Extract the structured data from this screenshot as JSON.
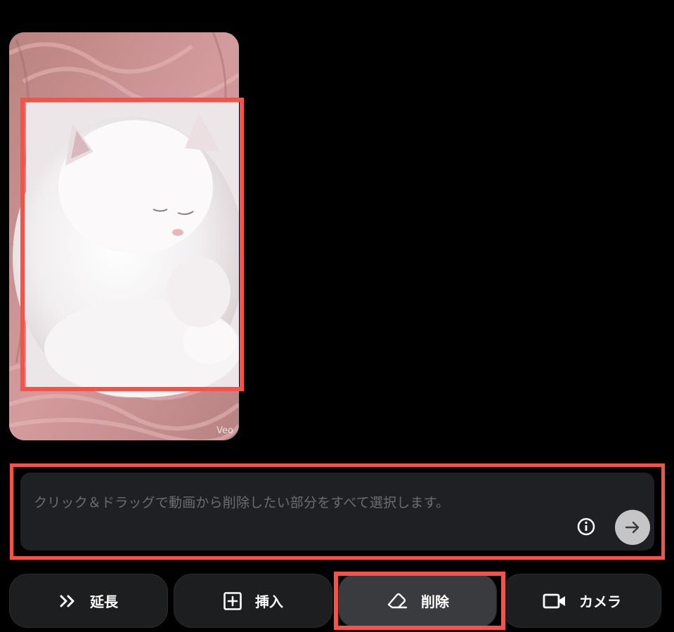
{
  "video": {
    "watermark": "Veo"
  },
  "prompt": {
    "placeholder": "クリック＆ドラッグで動画から削除したい部分をすべて選択します。",
    "info_icon": "info-icon",
    "send_icon": "arrow-right-icon"
  },
  "toolbar": {
    "extend_label": "延長",
    "insert_label": "挿入",
    "remove_label": "削除",
    "camera_label": "カメラ",
    "active": "remove"
  },
  "colors": {
    "highlight": "#f4534a",
    "background": "#000000",
    "panel": "#1f2023"
  }
}
